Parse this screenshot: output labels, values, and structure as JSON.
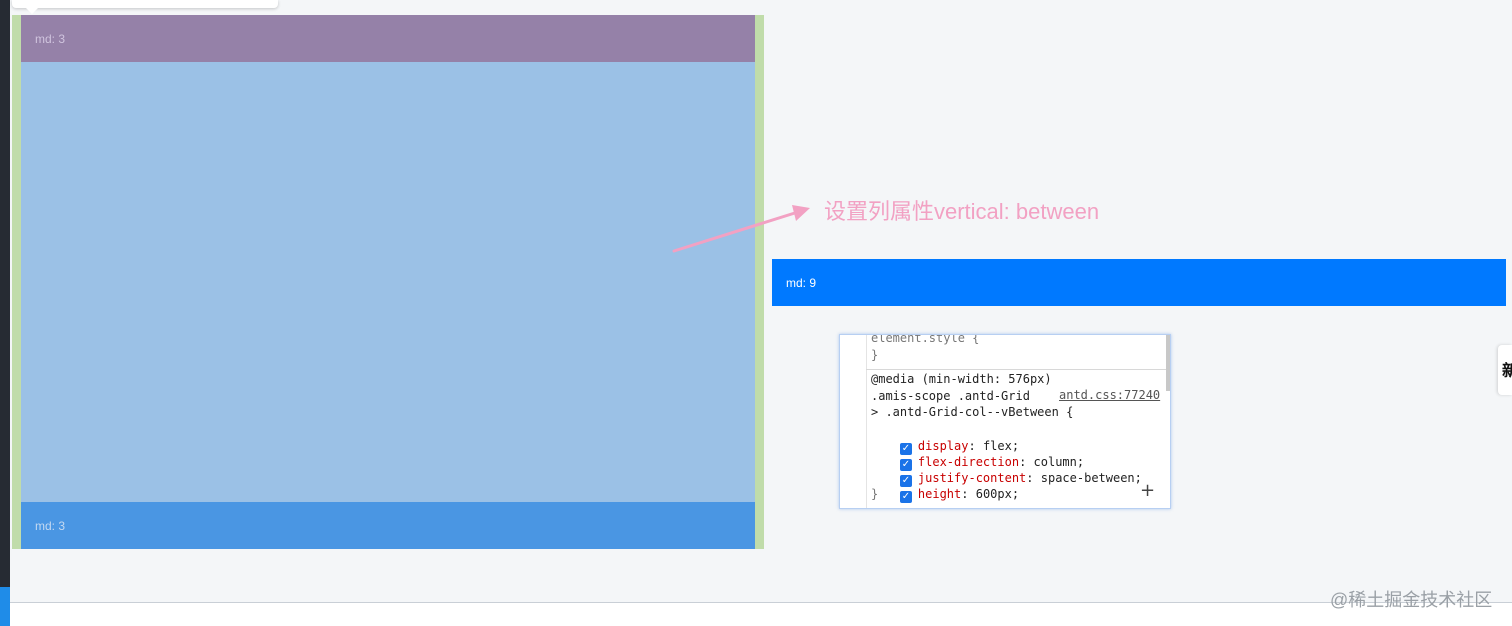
{
  "grid": {
    "left_top_label": "md: 3",
    "left_bottom_label": "md: 3",
    "right_label": "md: 9"
  },
  "annotation": {
    "text": "设置列属性vertical: between"
  },
  "devtools": {
    "element_style": "element.style {",
    "close_brace": "}",
    "media_query": "@media (min-width: 576px)",
    "selector_line1": ".amis-scope .antd-Grid",
    "selector_line2": "> .antd-Grid-col--vBetween {",
    "source_link": "antd.css:77240",
    "declarations": [
      {
        "prop": "display",
        "value": " flex;"
      },
      {
        "prop": "flex-direction",
        "value": " column;"
      },
      {
        "prop": "justify-content",
        "value": " space-between;"
      },
      {
        "prop": "height",
        "value": " 600px;"
      }
    ],
    "add_label": "+"
  },
  "edge_tab": {
    "text": "新"
  },
  "watermark": "@稀土掘金技术社区",
  "colors": {
    "purple_row": "#9581a8",
    "light_blue": "#9bc1e6",
    "mid_blue": "#4a96e3",
    "brand_blue": "#0079ff",
    "green_frame": "#c0dcaa",
    "annotation_pink": "#f2a1c3"
  }
}
